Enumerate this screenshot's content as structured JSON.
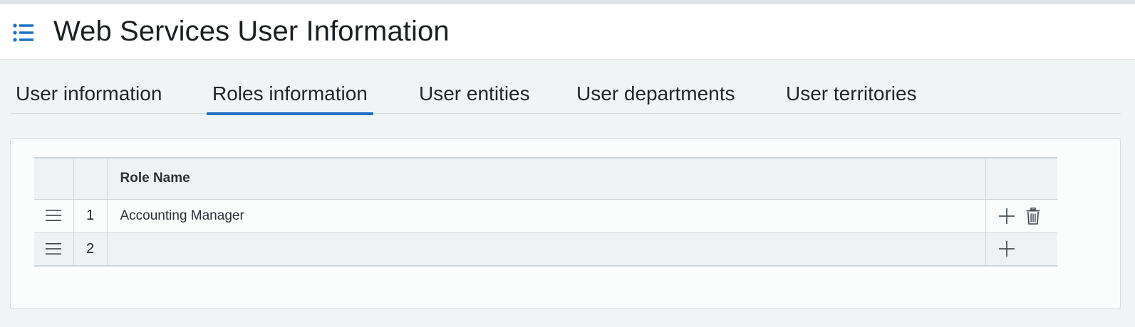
{
  "header": {
    "title": "Web Services User Information",
    "menu_icon": "list-icon",
    "accent_color": "#1a72c4"
  },
  "tabs": [
    {
      "label": "User information",
      "active": false
    },
    {
      "label": "Roles information",
      "active": true
    },
    {
      "label": "User entities",
      "active": false
    },
    {
      "label": "User departments",
      "active": false
    },
    {
      "label": "User territories",
      "active": false
    }
  ],
  "roles_table": {
    "columns": [
      "",
      "",
      "Role Name",
      ""
    ],
    "rows": [
      {
        "num": "1",
        "role_name": "Accounting Manager",
        "actions": [
          "add-icon",
          "trash-icon"
        ]
      },
      {
        "num": "2",
        "role_name": "",
        "actions": [
          "add-icon"
        ]
      }
    ]
  }
}
